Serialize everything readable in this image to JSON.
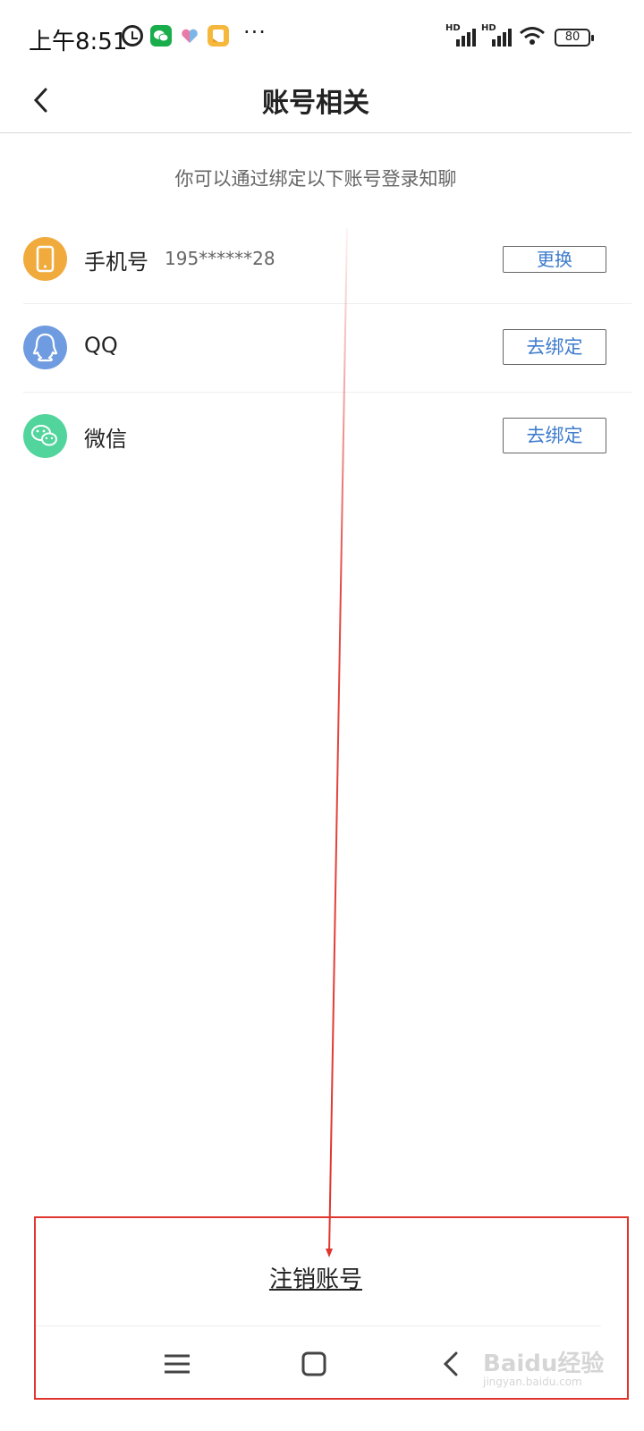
{
  "status_bar": {
    "time": "上午8:51",
    "battery": "80",
    "more": "···",
    "signal_hd": "HD"
  },
  "header": {
    "title": "账号相关"
  },
  "hint": "你可以通过绑定以下账号登录知聊",
  "accounts": [
    {
      "label": "手机号",
      "value": "195******28",
      "button": "更换",
      "icon": "phone-icon",
      "color": "#f0ab3c"
    },
    {
      "label": "QQ",
      "button": "去绑定",
      "icon": "qq-icon",
      "color": "#6f9be0"
    },
    {
      "label": "微信",
      "button": "去绑定",
      "icon": "wechat-icon",
      "color": "#52d59c"
    }
  ],
  "footer": {
    "cancel_account": "注销账号"
  },
  "annotation": {
    "color": "#e0352e"
  },
  "watermark": {
    "text": "Baidu经验",
    "sub": "jingyan.baidu.com"
  }
}
